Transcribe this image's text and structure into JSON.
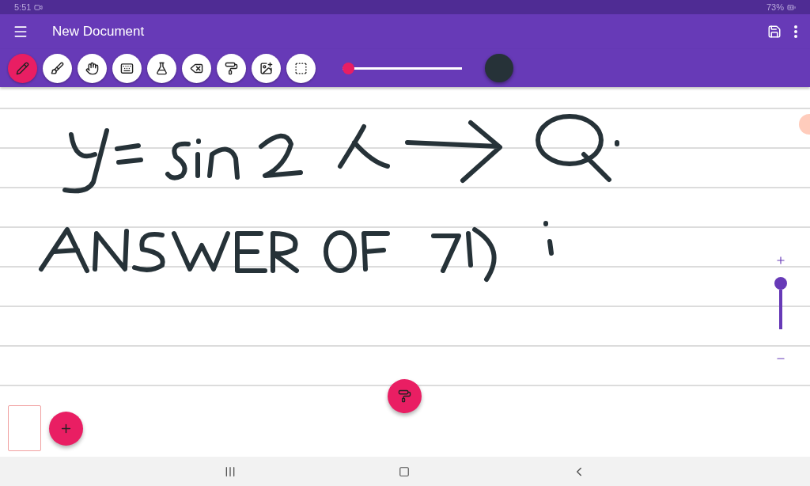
{
  "status_bar": {
    "time": "5:51",
    "battery": "73%"
  },
  "app_bar": {
    "title": "New Document"
  },
  "toolbar": {
    "tools": [
      {
        "kind": "pen",
        "selected": true
      },
      {
        "kind": "brush",
        "selected": false
      },
      {
        "kind": "hand",
        "selected": false
      },
      {
        "kind": "keyboard",
        "selected": false
      },
      {
        "kind": "flask",
        "selected": false
      },
      {
        "kind": "eraser",
        "selected": false
      },
      {
        "kind": "roller",
        "selected": false
      },
      {
        "kind": "image",
        "selected": false
      },
      {
        "kind": "select",
        "selected": false
      }
    ],
    "stroke_size": {
      "level": 0.05
    },
    "pen_color": {
      "color": "#263238"
    }
  },
  "zoom_slider": {
    "level": 1
  }
}
